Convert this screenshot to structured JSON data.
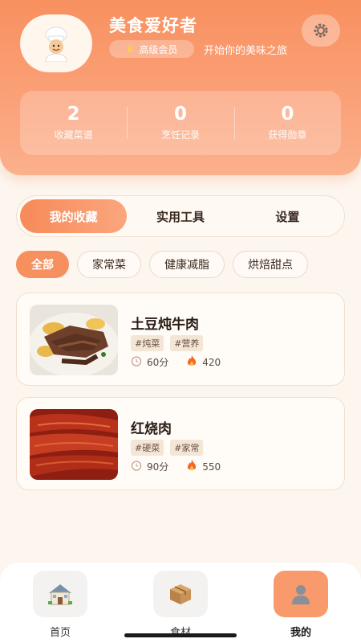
{
  "profile": {
    "name": "美食爱好者",
    "badge": "高级会员",
    "tagline": "开始你的美味之旅",
    "avatar_icon": "chef-avatar-icon"
  },
  "stats": [
    {
      "value": "2",
      "label": "收藏菜谱"
    },
    {
      "value": "0",
      "label": "烹饪记录"
    },
    {
      "value": "0",
      "label": "获得勋章"
    }
  ],
  "tabs": [
    {
      "label": "我的收藏",
      "active": true
    },
    {
      "label": "实用工具",
      "active": false
    },
    {
      "label": "设置",
      "active": false
    }
  ],
  "chips": [
    {
      "label": "全部",
      "active": true
    },
    {
      "label": "家常菜",
      "active": false
    },
    {
      "label": "健康减脂",
      "active": false
    },
    {
      "label": "烘焙甜点",
      "active": false
    }
  ],
  "recipes": [
    {
      "title": "土豆炖牛肉",
      "tags": [
        "#炖菜",
        "#营养"
      ],
      "time": "60分",
      "calories": "420"
    },
    {
      "title": "红烧肉",
      "tags": [
        "#硬菜",
        "#家常"
      ],
      "time": "90分",
      "calories": "550"
    }
  ],
  "nav": [
    {
      "label": "首页",
      "icon": "house-icon",
      "active": false
    },
    {
      "label": "食材",
      "icon": "package-icon",
      "active": false
    },
    {
      "label": "我的",
      "icon": "user-icon",
      "active": true
    }
  ],
  "colors": {
    "accent": "#f7905f",
    "background": "#fdf6ef"
  }
}
